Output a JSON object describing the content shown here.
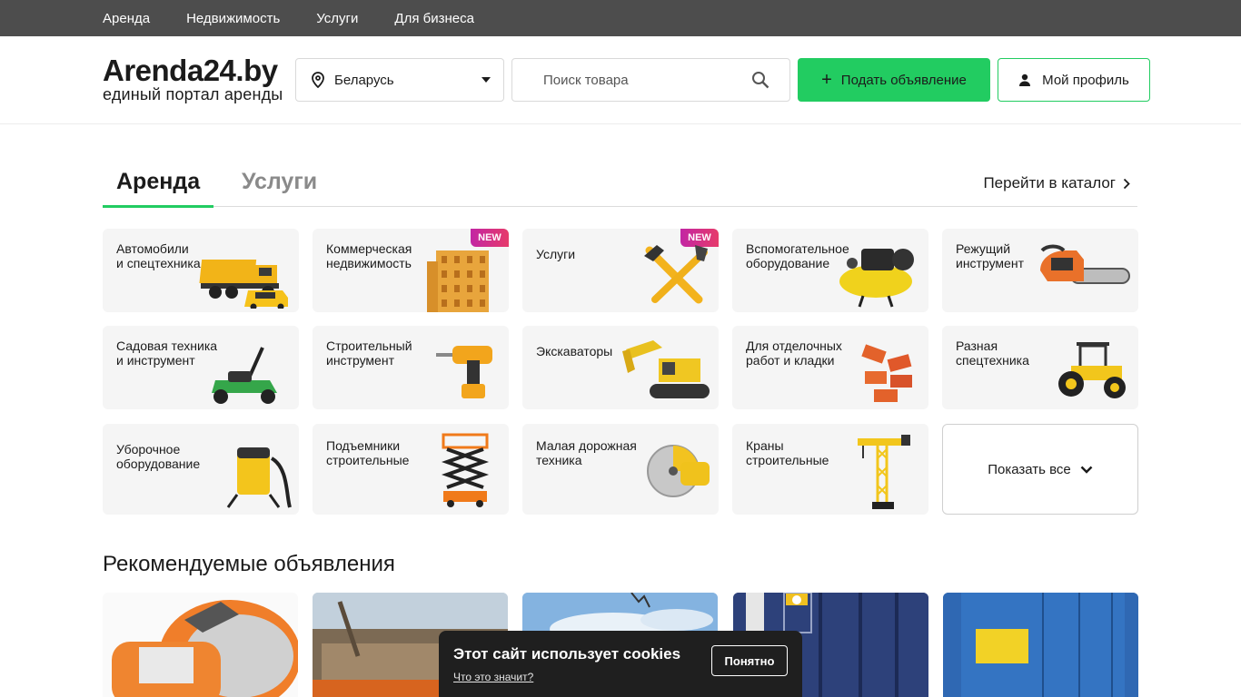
{
  "top_nav": [
    "Аренда",
    "Недвижимость",
    "Услуги",
    "Для бизнеса"
  ],
  "logo": {
    "title": "Arenda24.by",
    "subtitle": "единый портал аренды"
  },
  "region": {
    "value": "Беларусь",
    "icon": "location-pin-icon"
  },
  "search": {
    "placeholder": "Поиск товара",
    "icon": "search-icon"
  },
  "post_button": {
    "label": "Подать объявление",
    "icon": "plus-icon"
  },
  "profile_button": {
    "label": "Мой профиль",
    "icon": "user-icon"
  },
  "tabs": {
    "active": "Аренда",
    "inactive": "Услуги"
  },
  "catalog_link": "Перейти в каталог",
  "categories": [
    {
      "label": "Автомобили\nи спецтехника",
      "icon": "dump-truck-icon",
      "badge": ""
    },
    {
      "label": "Коммерческая\nнедвижимость",
      "icon": "building-icon",
      "badge": "NEW"
    },
    {
      "label": "Услуги",
      "icon": "tools-icon",
      "badge": "NEW"
    },
    {
      "label": "Вспомогательное\nоборудование",
      "icon": "compressor-icon",
      "badge": ""
    },
    {
      "label": "Режущий\nинструмент",
      "icon": "chainsaw-icon",
      "badge": ""
    },
    {
      "label": "Садовая техника\nи инструмент",
      "icon": "lawn-mower-icon",
      "badge": ""
    },
    {
      "label": "Строительный\nинструмент",
      "icon": "drill-icon",
      "badge": ""
    },
    {
      "label": "Экскаваторы",
      "icon": "excavator-icon",
      "badge": ""
    },
    {
      "label": "Для отделочных\nработ и кладки",
      "icon": "bricks-icon",
      "badge": ""
    },
    {
      "label": "Разная\nспецтехника",
      "icon": "tractor-icon",
      "badge": ""
    },
    {
      "label": "Уборочное\nоборудование",
      "icon": "vacuum-icon",
      "badge": ""
    },
    {
      "label": "Подъемники\nстроительные",
      "icon": "scissor-lift-icon",
      "badge": ""
    },
    {
      "label": "Малая дорожная\nтехника",
      "icon": "cutoff-saw-icon",
      "badge": ""
    },
    {
      "label": "Краны\nстроительные",
      "icon": "crane-icon",
      "badge": ""
    }
  ],
  "show_all": "Показать все",
  "recommended_title": "Рекомендуемые объявления",
  "cookie": {
    "title": "Этот сайт использует cookies",
    "link": "Что это значит?",
    "button": "Понятно"
  },
  "colors": {
    "accent": "#22cc61",
    "topbar": "#4d4d4d",
    "card_bg": "#f5f5f5"
  }
}
